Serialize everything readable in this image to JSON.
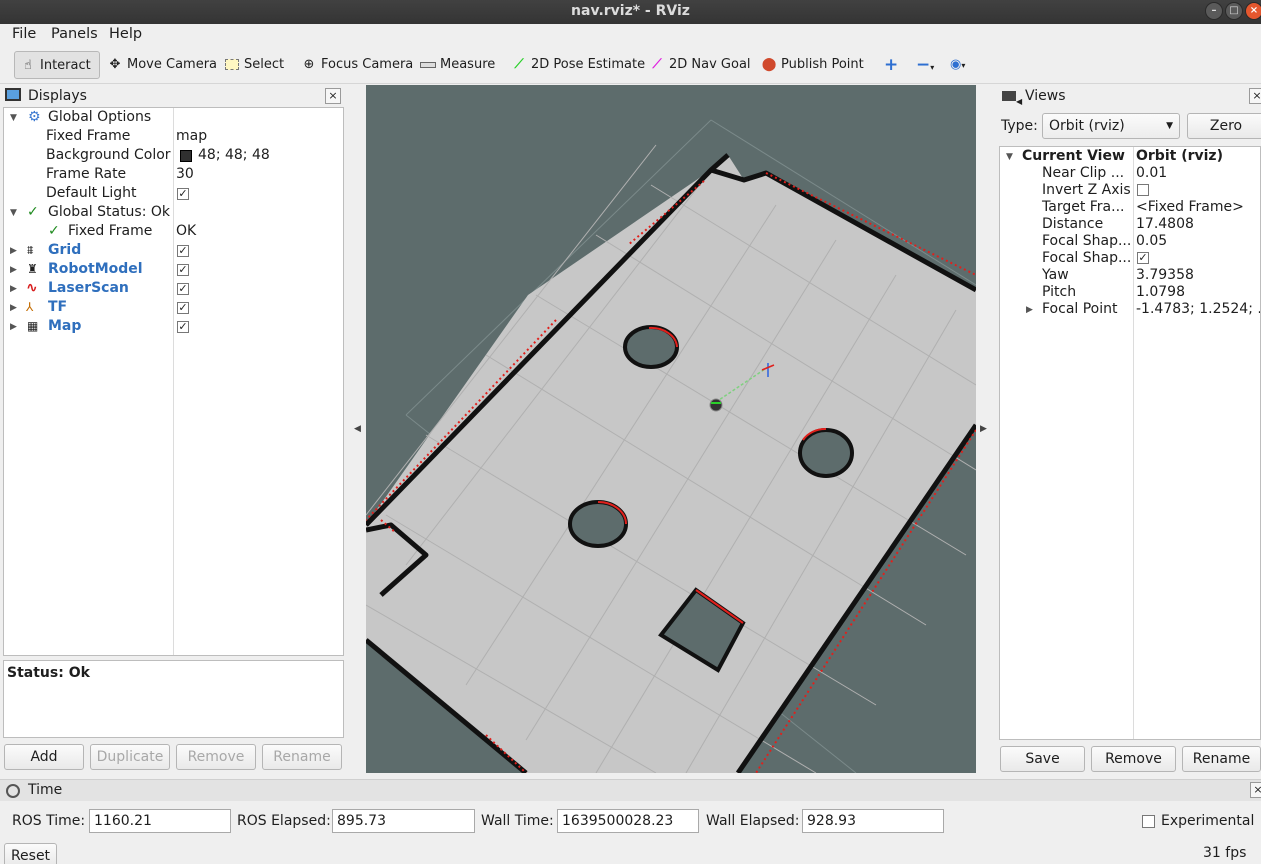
{
  "window": {
    "title": "nav.rviz* - RViz"
  },
  "menu": {
    "file": "File",
    "panels": "Panels",
    "help": "Help"
  },
  "toolbar": {
    "interact": "Interact",
    "move_camera": "Move Camera",
    "select": "Select",
    "focus_camera": "Focus Camera",
    "measure": "Measure",
    "pose_estimate": "2D Pose Estimate",
    "nav_goal": "2D Nav Goal",
    "publish_point": "Publish Point"
  },
  "displays": {
    "title": "Displays",
    "global_options": {
      "label": "Global Options",
      "fixed_frame": {
        "label": "Fixed Frame",
        "value": "map"
      },
      "background_color": {
        "label": "Background Color",
        "value": "48; 48; 48",
        "swatch": "#303030"
      },
      "frame_rate": {
        "label": "Frame Rate",
        "value": "30"
      },
      "default_light": {
        "label": "Default Light",
        "checked": true
      }
    },
    "global_status": {
      "label": "Global Status: Ok",
      "fixed_frame": {
        "label": "Fixed Frame",
        "value": "OK"
      }
    },
    "items": [
      {
        "label": "Grid",
        "icon": "grid-icon",
        "checked": true
      },
      {
        "label": "RobotModel",
        "icon": "robot-icon",
        "checked": true
      },
      {
        "label": "LaserScan",
        "icon": "laser-icon",
        "checked": true
      },
      {
        "label": "TF",
        "icon": "tf-icon",
        "checked": true
      },
      {
        "label": "Map",
        "icon": "map-icon",
        "checked": true
      }
    ],
    "status": "Status: Ok",
    "buttons": {
      "add": "Add",
      "duplicate": "Duplicate",
      "remove": "Remove",
      "rename": "Rename"
    }
  },
  "views": {
    "title": "Views",
    "type_label": "Type:",
    "type_value": "Orbit (rviz)",
    "zero": "Zero",
    "current_view": {
      "label": "Current View",
      "value": "Orbit (rviz)"
    },
    "props": [
      {
        "label": "Near Clip ...",
        "value": "0.01"
      },
      {
        "label": "Invert Z Axis",
        "value": "",
        "checkbox": true,
        "checked": false
      },
      {
        "label": "Target Fra...",
        "value": "<Fixed Frame>"
      },
      {
        "label": "Distance",
        "value": "17.4808"
      },
      {
        "label": "Focal Shap...",
        "value": "0.05"
      },
      {
        "label": "Focal Shap...",
        "value": "",
        "checkbox": true,
        "checked": true
      },
      {
        "label": "Yaw",
        "value": "3.79358"
      },
      {
        "label": "Pitch",
        "value": "1.0798"
      },
      {
        "label": "Focal Point",
        "value": "-1.4783; 1.2524; ..."
      }
    ],
    "buttons": {
      "save": "Save",
      "remove": "Remove",
      "rename": "Rename"
    }
  },
  "time": {
    "title": "Time",
    "ros_time": {
      "label": "ROS Time:",
      "value": "1160.21"
    },
    "ros_elapsed": {
      "label": "ROS Elapsed:",
      "value": "895.73"
    },
    "wall_time": {
      "label": "Wall Time:",
      "value": "1639500028.23"
    },
    "wall_elapsed": {
      "label": "Wall Elapsed:",
      "value": "928.93"
    },
    "experimental": "Experimental",
    "reset": "Reset",
    "fps": "31 fps"
  },
  "colors": {
    "viewport_bg": "#5d6c6c",
    "map_floor": "#c8c8c8",
    "wall": "#111111",
    "laser": "#e0201c",
    "link_blue": "#2f6fbd"
  }
}
